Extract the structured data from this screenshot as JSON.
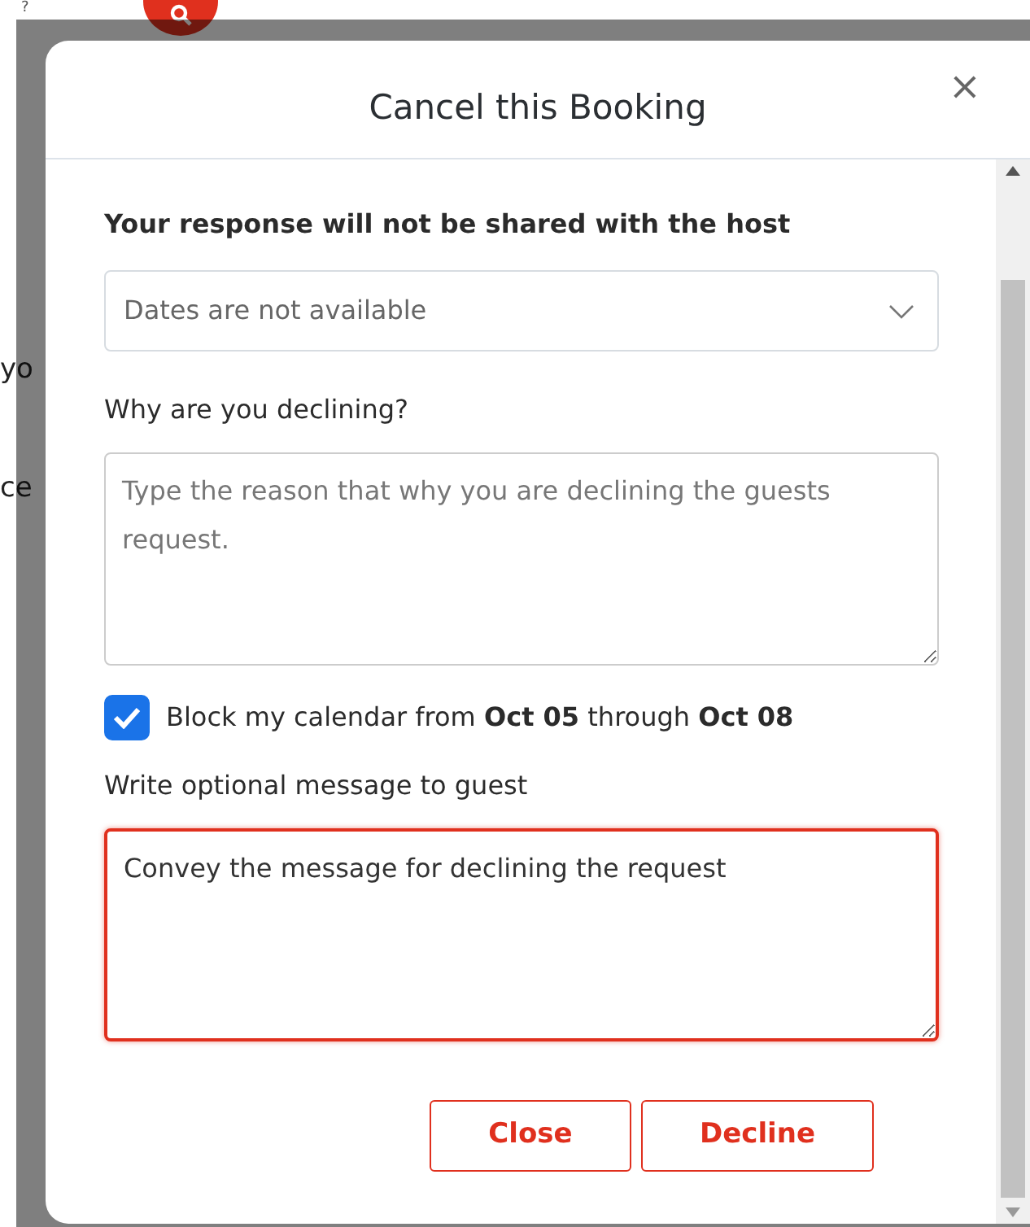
{
  "background": {
    "texts": [
      "?",
      "yo",
      "ce"
    ]
  },
  "modal": {
    "title": "Cancel this Booking",
    "close": "×",
    "note": "Your response will not be shared with the host",
    "reason_select": {
      "value": "Dates are not available"
    },
    "decline_label": "Why are you declining?",
    "decline_reason": {
      "placeholder": "Type the reason that why you are declining the guests request."
    },
    "block_calendar": {
      "checked": true,
      "label": "Block my calendar from **Oct 05** through **Oct 08**"
    },
    "message_label": "Write optional message to guest",
    "message": {
      "value": "Convey the message for declining the request",
      "focused": true
    },
    "buttons": [
      "Close",
      "Decline"
    ]
  }
}
